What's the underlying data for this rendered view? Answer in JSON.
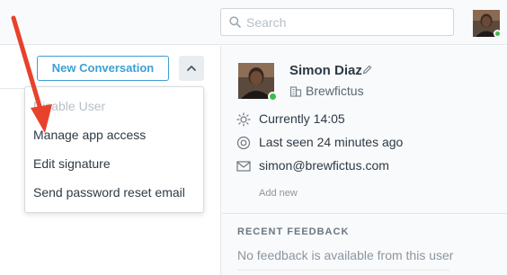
{
  "topbar": {
    "search": {
      "placeholder": "Search",
      "value": ""
    }
  },
  "conversation": {
    "new_conversation_label": "New Conversation",
    "menu": {
      "items": [
        {
          "label": "Disable User",
          "disabled": true
        },
        {
          "label": "Manage app access",
          "disabled": false
        },
        {
          "label": "Edit signature",
          "disabled": false
        },
        {
          "label": "Send password reset email",
          "disabled": false
        }
      ]
    }
  },
  "profile": {
    "name": "Simon Diaz",
    "company": "Brewfictus",
    "local_time": "Currently 14:05",
    "last_seen": "Last seen 24 minutes ago",
    "email": "simon@brewfictus.com",
    "add_new_label": "Add new",
    "status": "online"
  },
  "feedback": {
    "title": "RECENT FEEDBACK",
    "empty_text": "No feedback is available from this user"
  },
  "colors": {
    "accent": "#3d9fd3",
    "online": "#3fb950",
    "annotation_arrow": "#e8412c"
  },
  "icons": [
    "search-icon",
    "avatar",
    "chevron-up-icon",
    "pencil-icon",
    "building-icon",
    "sun-icon",
    "eye-icon",
    "mail-icon"
  ]
}
